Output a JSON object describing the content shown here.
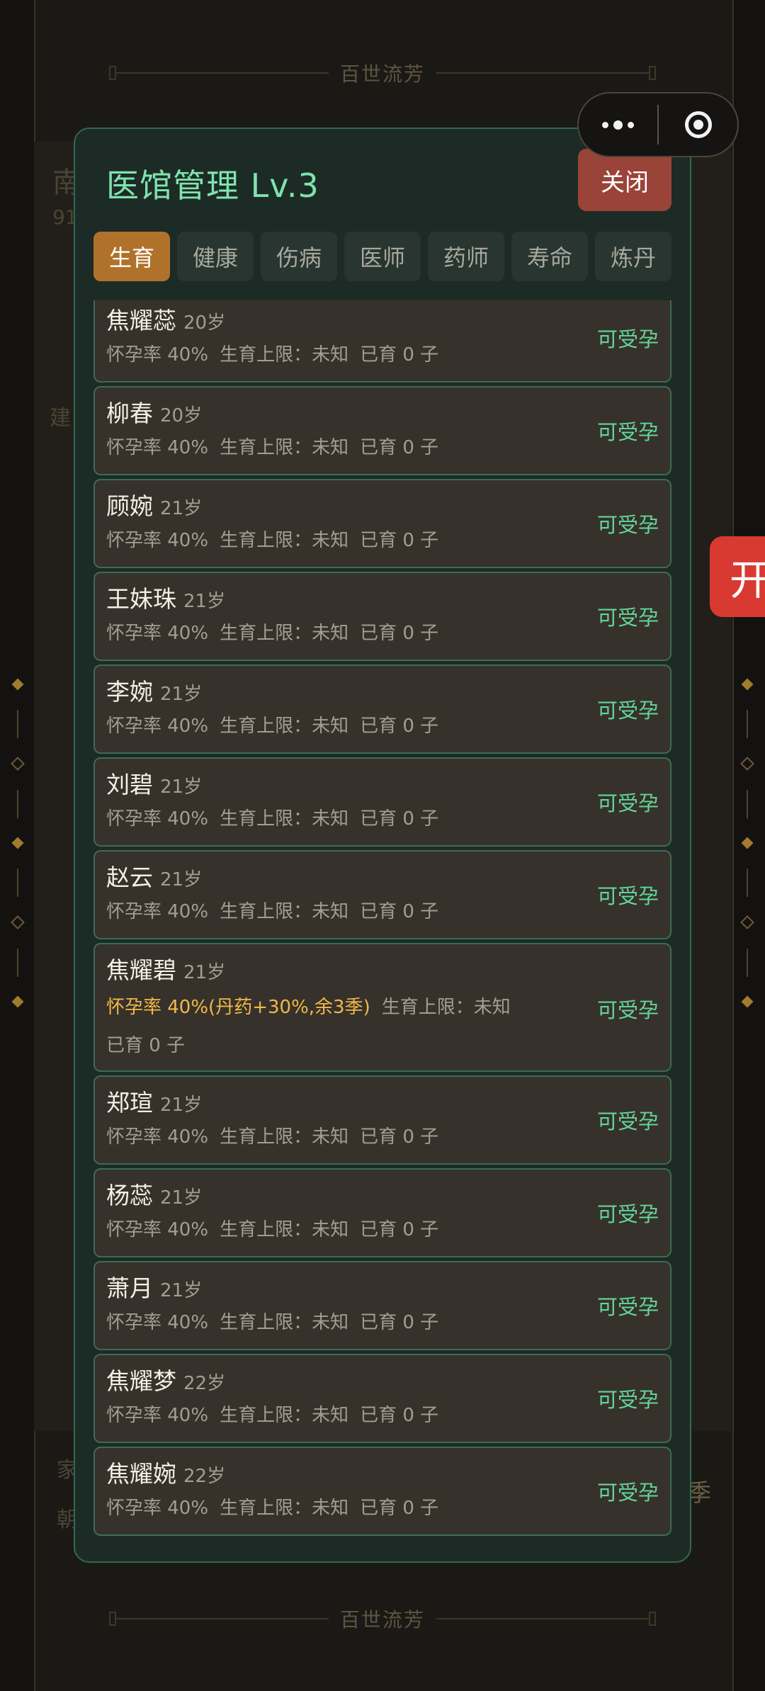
{
  "background": {
    "banner_text": "百世流芳",
    "ghost_texts": [
      "南",
      "91",
      "建",
      "家",
      "朝"
    ],
    "side_tab_text": "开",
    "right_peek_text": "季"
  },
  "modal": {
    "title": "医馆管理 Lv.3",
    "close_label": "关闭",
    "tabs": [
      {
        "label": "生育",
        "active": true
      },
      {
        "label": "健康",
        "active": false
      },
      {
        "label": "伤病",
        "active": false
      },
      {
        "label": "医师",
        "active": false
      },
      {
        "label": "药师",
        "active": false
      },
      {
        "label": "寿命",
        "active": false
      },
      {
        "label": "炼丹",
        "active": false
      }
    ],
    "entries": [
      {
        "name": "焦耀蕊",
        "age": "20岁",
        "rate": "怀孕率 40%",
        "limit": "生育上限：未知",
        "born": "已育 0 子",
        "status": "可受孕"
      },
      {
        "name": "柳春",
        "age": "20岁",
        "rate": "怀孕率 40%",
        "limit": "生育上限：未知",
        "born": "已育 0 子",
        "status": "可受孕"
      },
      {
        "name": "顾婉",
        "age": "21岁",
        "rate": "怀孕率 40%",
        "limit": "生育上限：未知",
        "born": "已育 0 子",
        "status": "可受孕"
      },
      {
        "name": "王妹珠",
        "age": "21岁",
        "rate": "怀孕率 40%",
        "limit": "生育上限：未知",
        "born": "已育 0 子",
        "status": "可受孕"
      },
      {
        "name": "李婉",
        "age": "21岁",
        "rate": "怀孕率 40%",
        "limit": "生育上限：未知",
        "born": "已育 0 子",
        "status": "可受孕"
      },
      {
        "name": "刘碧",
        "age": "21岁",
        "rate": "怀孕率 40%",
        "limit": "生育上限：未知",
        "born": "已育 0 子",
        "status": "可受孕"
      },
      {
        "name": "赵云",
        "age": "21岁",
        "rate": "怀孕率 40%",
        "limit": "生育上限：未知",
        "born": "已育 0 子",
        "status": "可受孕"
      },
      {
        "name": "焦耀碧",
        "age": "21岁",
        "rate": "怀孕率 40%(丹药+30%,余3季)",
        "limit": "生育上限：未知",
        "born": "已育 0 子",
        "status": "可受孕",
        "boosted": true
      },
      {
        "name": "郑瑄",
        "age": "21岁",
        "rate": "怀孕率 40%",
        "limit": "生育上限：未知",
        "born": "已育 0 子",
        "status": "可受孕"
      },
      {
        "name": "杨蕊",
        "age": "21岁",
        "rate": "怀孕率 40%",
        "limit": "生育上限：未知",
        "born": "已育 0 子",
        "status": "可受孕"
      },
      {
        "name": "萧月",
        "age": "21岁",
        "rate": "怀孕率 40%",
        "limit": "生育上限：未知",
        "born": "已育 0 子",
        "status": "可受孕"
      },
      {
        "name": "焦耀梦",
        "age": "22岁",
        "rate": "怀孕率 40%",
        "limit": "生育上限：未知",
        "born": "已育 0 子",
        "status": "可受孕"
      },
      {
        "name": "焦耀婉",
        "age": "22岁",
        "rate": "怀孕率 40%",
        "limit": "生育上限：未知",
        "born": "已育 0 子",
        "status": "可受孕"
      }
    ]
  }
}
